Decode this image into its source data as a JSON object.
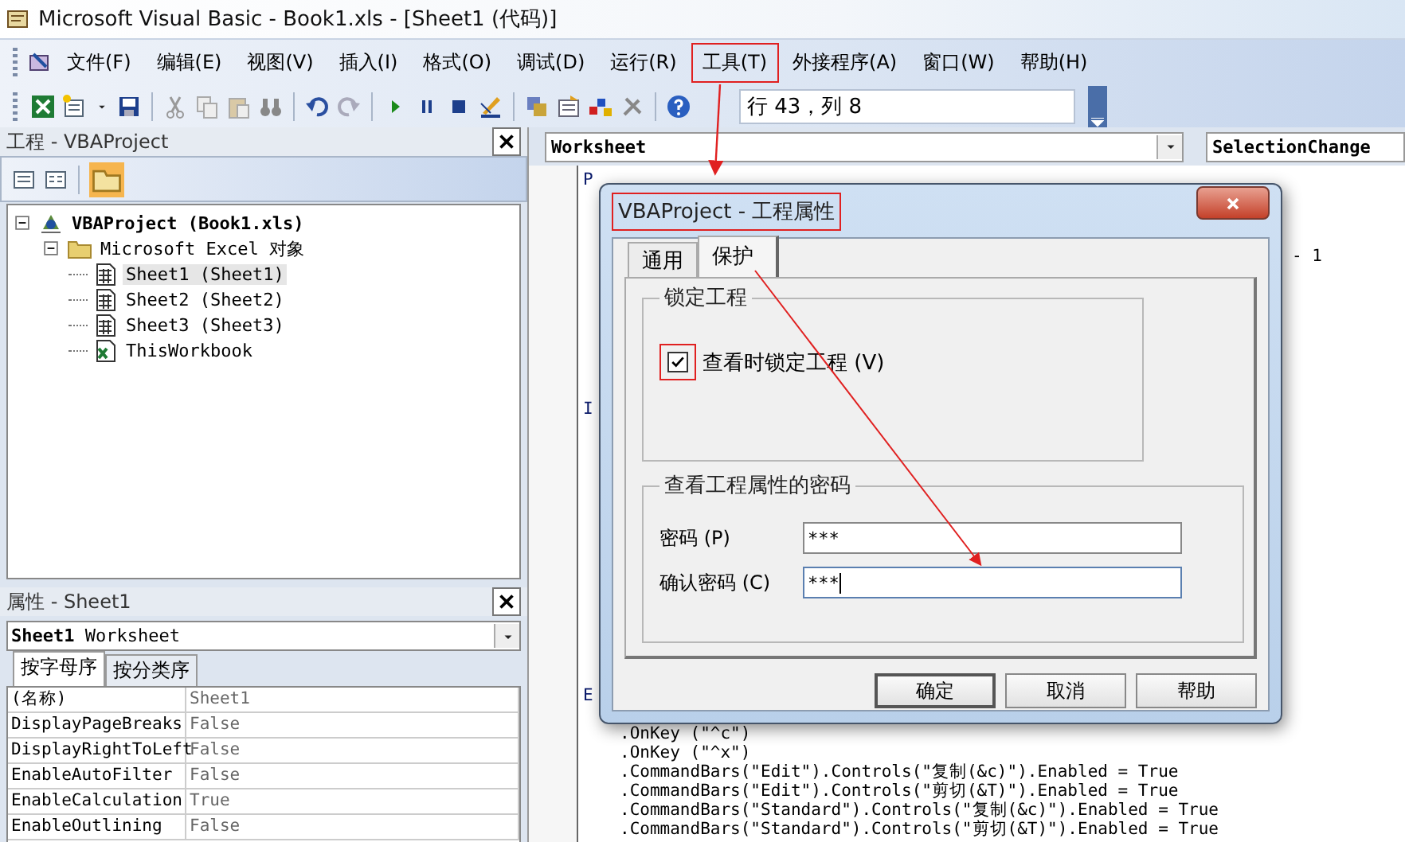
{
  "window": {
    "title": "Microsoft Visual Basic - Book1.xls - [Sheet1 (代码)]"
  },
  "menu": [
    {
      "label": "文件(F)",
      "marked": false
    },
    {
      "label": "编辑(E)",
      "marked": false
    },
    {
      "label": "视图(V)",
      "marked": false
    },
    {
      "label": "插入(I)",
      "marked": false
    },
    {
      "label": "格式(O)",
      "marked": false
    },
    {
      "label": "调试(D)",
      "marked": false
    },
    {
      "label": "运行(R)",
      "marked": false
    },
    {
      "label": "工具(T)",
      "marked": true
    },
    {
      "label": "外接程序(A)",
      "marked": false
    },
    {
      "label": "窗口(W)",
      "marked": false
    },
    {
      "label": "帮助(H)",
      "marked": false
    }
  ],
  "toolbar": {
    "position": "行 43，列 8"
  },
  "project_panel": {
    "title": "工程 - VBAProject",
    "tree": [
      {
        "label": "VBAProject (Book1.xls)",
        "kind": "project",
        "expanded": true,
        "selected": false,
        "children": [
          {
            "label": "Microsoft Excel 对象",
            "kind": "folder",
            "expanded": true,
            "selected": false,
            "children": [
              {
                "label": "Sheet1 (Sheet1)",
                "kind": "sheet",
                "selected": true
              },
              {
                "label": "Sheet2 (Sheet2)",
                "kind": "sheet",
                "selected": false
              },
              {
                "label": "Sheet3 (Sheet3)",
                "kind": "sheet",
                "selected": false
              },
              {
                "label": "ThisWorkbook",
                "kind": "workbook",
                "selected": false
              }
            ]
          }
        ]
      }
    ]
  },
  "properties_panel": {
    "title": "属性 - Sheet1",
    "object": {
      "name": "Sheet1",
      "type": "Worksheet"
    },
    "tabs": [
      {
        "label": "按字母序",
        "selected": true
      },
      {
        "label": "按分类序",
        "selected": false
      }
    ],
    "rows": [
      {
        "name": "(名称)",
        "value": "Sheet1"
      },
      {
        "name": "DisplayPageBreaks",
        "value": "False"
      },
      {
        "name": "DisplayRightToLeft",
        "value": "False"
      },
      {
        "name": "EnableAutoFilter",
        "value": "False"
      },
      {
        "name": "EnableCalculation",
        "value": "True"
      },
      {
        "name": "EnableOutlining",
        "value": "False"
      }
    ]
  },
  "code_window": {
    "object": "Worksheet",
    "procedure": "SelectionChange",
    "lines": [
      {
        "kind": "code",
        "text": "P"
      },
      {
        "kind": "covered"
      },
      {
        "kind": "covered"
      },
      {
        "kind": "covered"
      },
      {
        "kind": "tail",
        "text": "- 1"
      },
      {
        "kind": "covered"
      },
      {
        "kind": "covered"
      },
      {
        "kind": "covered"
      },
      {
        "kind": "covered"
      },
      {
        "kind": "covered"
      },
      {
        "kind": "covered"
      },
      {
        "kind": "covered"
      },
      {
        "kind": "code",
        "text": "I"
      },
      {
        "kind": "covered"
      },
      {
        "kind": "covered"
      },
      {
        "kind": "covered"
      },
      {
        "kind": "covered"
      },
      {
        "kind": "covered"
      },
      {
        "kind": "covered"
      },
      {
        "kind": "covered"
      },
      {
        "kind": "covered"
      },
      {
        "kind": "covered"
      },
      {
        "kind": "covered"
      },
      {
        "kind": "covered"
      },
      {
        "kind": "covered"
      },
      {
        "kind": "covered"
      },
      {
        "kind": "covered"
      },
      {
        "kind": "code",
        "text": "E"
      },
      {
        "kind": "covered"
      },
      {
        "kind": "indented",
        "text": ".OnKey (\"^c\")"
      },
      {
        "kind": "indented",
        "text": ".OnKey (\"^x\")"
      },
      {
        "kind": "indented",
        "text": ".CommandBars(\"Edit\").Controls(\"复制(&c)\").Enabled = True"
      },
      {
        "kind": "indented",
        "text": ".CommandBars(\"Edit\").Controls(\"剪切(&T)\").Enabled = True"
      },
      {
        "kind": "indented",
        "text": ".CommandBars(\"Standard\").Controls(\"复制(&c)\").Enabled = True"
      },
      {
        "kind": "indented",
        "text": ".CommandBars(\"Standard\").Controls(\"剪切(&T)\").Enabled = True"
      }
    ]
  },
  "dialog": {
    "title": "VBAProject - 工程属性",
    "title_marked": true,
    "tabs": [
      {
        "label": "通用",
        "selected": false
      },
      {
        "label": "保护",
        "selected": true
      }
    ],
    "lock_group": {
      "title": "锁定工程",
      "checkbox": {
        "label": "查看时锁定工程 (V)",
        "checked": true,
        "marked": true
      }
    },
    "password_group": {
      "title": "查看工程属性的密码",
      "fields": [
        {
          "label": "密码 (P)",
          "value": "***",
          "focused": false
        },
        {
          "label": "确认密码 (C)",
          "value": "***",
          "focused": true
        }
      ]
    },
    "buttons": [
      {
        "label": "确定",
        "default": true
      },
      {
        "label": "取消",
        "default": false
      },
      {
        "label": "帮助",
        "default": false
      }
    ]
  }
}
